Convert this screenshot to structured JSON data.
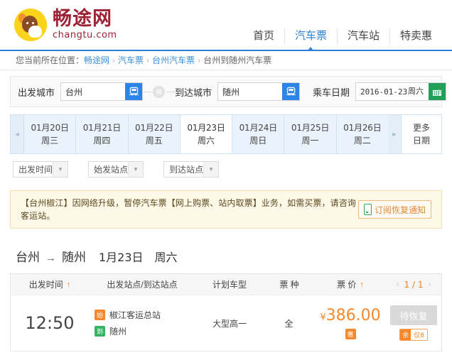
{
  "site": {
    "logo_cn": "畅途网",
    "logo_en": "changtu.com"
  },
  "nav": {
    "items": [
      {
        "label": "首页",
        "active": false
      },
      {
        "label": "汽车票",
        "active": true
      },
      {
        "label": "汽车站",
        "active": false
      },
      {
        "label": "特卖惠",
        "active": false
      }
    ]
  },
  "breadcrumb": {
    "label": "您当前所在位置：",
    "items": [
      "畅途网",
      "汽车票",
      "台州汽车票"
    ],
    "separator": "›",
    "current": "台州到随州汽车票"
  },
  "search": {
    "from_label": "出发城市",
    "from_value": "台州",
    "from_icon": "bus-icon",
    "swap_label": "换",
    "to_label": "到达城市",
    "to_value": "随州",
    "to_icon": "bus-icon",
    "date_label": "乘车日期",
    "date_value": "2016-01-23",
    "date_week": "周六",
    "calendar_icon": "calendar-icon"
  },
  "date_tabs": {
    "prev_arrow": "◄",
    "next_arrow": "►",
    "more_line1": "更多",
    "more_line2": "日期",
    "items": [
      {
        "date": "01月20日",
        "week": "周三",
        "active": false
      },
      {
        "date": "01月21日",
        "week": "周四",
        "active": false
      },
      {
        "date": "01月22日",
        "week": "周五",
        "active": false
      },
      {
        "date": "01月23日",
        "week": "周六",
        "active": true
      },
      {
        "date": "01月24日",
        "week": "周日",
        "active": false
      },
      {
        "date": "01月25日",
        "week": "周一",
        "active": false
      },
      {
        "date": "01月26日",
        "week": "周二",
        "active": false
      }
    ]
  },
  "filters": [
    {
      "label": "出发时间"
    },
    {
      "label": "始发站点"
    },
    {
      "label": "到达站点"
    }
  ],
  "alert": {
    "text": "【台州椒江】因网络升级，暂停汽车票【网上购票、站内取票】业务，如需买票，请咨询客运站。",
    "button_label": "订阅恢复通知",
    "button_icon": "phone-icon"
  },
  "route": {
    "from": "台州",
    "arrow": "→",
    "to": "随州",
    "date": "1月23日",
    "week": "周六"
  },
  "table": {
    "columns": {
      "time": "出发时间",
      "station": "出发站点/到达站点",
      "model": "计划车型",
      "type": "票 种",
      "price": "票 价"
    },
    "sort_icon": "↑",
    "pagination": {
      "prev": "‹",
      "current": "1 / 1",
      "next": "›"
    },
    "rows": [
      {
        "depart_time": "12:50",
        "start_badge": "始",
        "start_station": "椒江客运总站",
        "end_badge": "到",
        "end_station": "随州",
        "model": "大型高一",
        "ticket_type": "全",
        "currency": "¥",
        "price": "386.00",
        "discount_badge": "惠",
        "action_label": "待恢复",
        "seat_label": "余",
        "seat_value": "仅8"
      }
    ]
  },
  "colors": {
    "brand_red": "#9d2235",
    "brand_yellow": "#fbd31a",
    "accent_blue": "#2b7fd4",
    "accent_orange": "#f5872c",
    "green": "#37b263"
  }
}
